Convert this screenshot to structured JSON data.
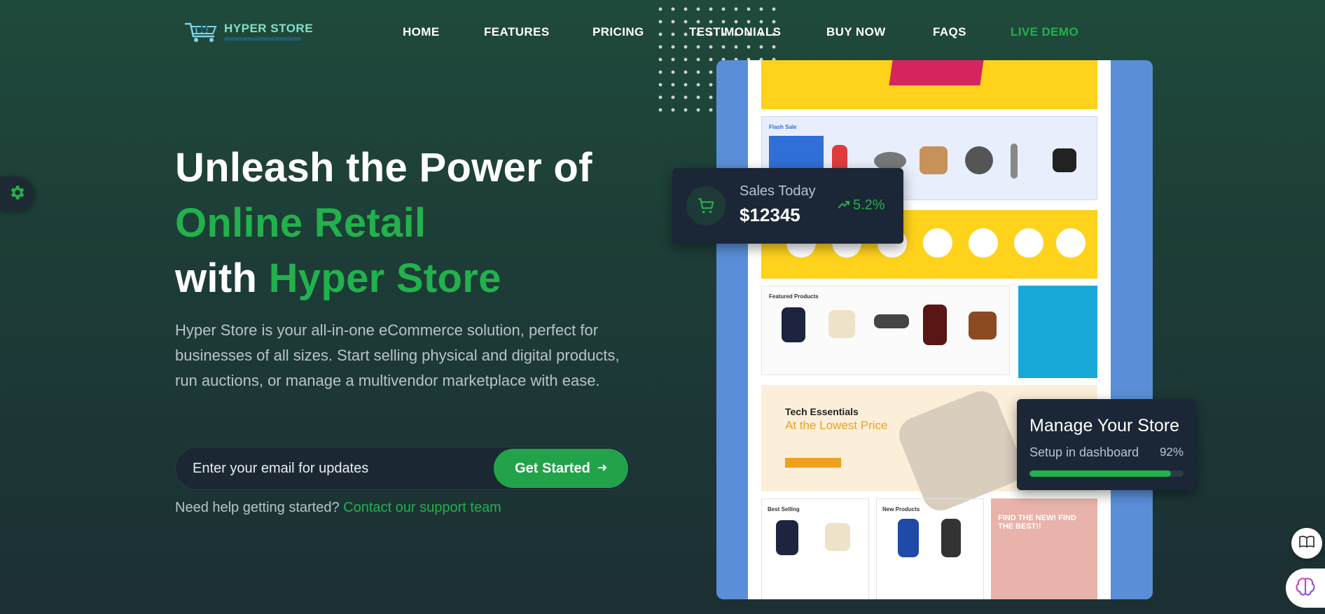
{
  "brand": {
    "name": "HYPER STORE"
  },
  "nav": {
    "items": [
      {
        "label": "HOME"
      },
      {
        "label": "FEATURES"
      },
      {
        "label": "PRICING"
      },
      {
        "label": "TESTIMONIALS"
      },
      {
        "label": "BUY NOW"
      },
      {
        "label": "FAQS"
      },
      {
        "label": "LIVE DEMO"
      }
    ]
  },
  "hero": {
    "title_line1": "Unleash the Power of",
    "title_line2": "Online Retail",
    "title_line3_prefix": "with",
    "title_line3_highlight": "Hyper Store",
    "description": "Hyper Store is your all-in-one eCommerce solution, perfect for businesses of all sizes. Start selling physical and digital products, run auctions, or manage a multivendor marketplace with ease.",
    "email_placeholder": "Enter your email for updates",
    "cta_label": "Get Started",
    "cta_icon": "arrow-right-icon",
    "help_text": "Need help getting started?",
    "help_link": "Contact our support team"
  },
  "sales_card": {
    "label": "Sales Today",
    "value": "$12345",
    "change": "5.2%",
    "icon": "cart-icon"
  },
  "manage_card": {
    "title": "Manage Your Store",
    "label": "Setup in dashboard",
    "percent_text": "92%",
    "progress": 0.92
  },
  "mockup": {
    "flash_title": "Flash Sale",
    "featured_title": "Featured Products",
    "tech_title": "Tech Essentials",
    "tech_subtitle": "At the Lowest Price",
    "best_title": "Best Selling",
    "new_title": "New Products",
    "find_text": "FIND THE NEW! FIND THE BEST!!"
  },
  "colors": {
    "accent": "#22b14c",
    "background": "#1f4a3b",
    "card": "#1b2736"
  }
}
